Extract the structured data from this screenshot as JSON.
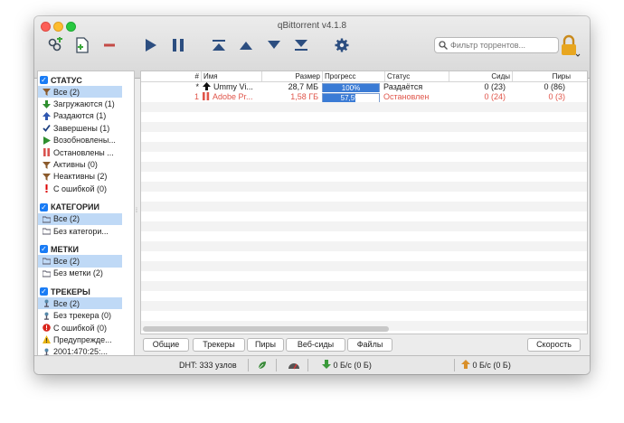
{
  "window": {
    "title": "qBittorrent v4.1.8"
  },
  "toolbar": {
    "buttons": [
      {
        "name": "add-link-icon"
      },
      {
        "name": "add-file-icon"
      },
      {
        "name": "remove-icon"
      },
      {
        "name": "resume-icon"
      },
      {
        "name": "pause-icon"
      },
      {
        "name": "move-top-icon"
      },
      {
        "name": "move-up-icon"
      },
      {
        "name": "move-down-icon"
      },
      {
        "name": "move-bottom-icon"
      },
      {
        "name": "gear-icon"
      }
    ],
    "search_placeholder": "Фильтр торрентов..."
  },
  "sidebar": {
    "status": {
      "title": "СТАТУС",
      "items": [
        {
          "label": "Все (2)",
          "icon": "filter-icon",
          "selected": true
        },
        {
          "label": "Загружаются (1)",
          "icon": "download-arrow-icon"
        },
        {
          "label": "Раздаются (1)",
          "icon": "upload-arrow-icon"
        },
        {
          "label": "Завершены (1)",
          "icon": "checkmark-icon"
        },
        {
          "label": "Возобновлены...",
          "icon": "play-icon"
        },
        {
          "label": "Остановлены ...",
          "icon": "pause-icon"
        },
        {
          "label": "Активны (0)",
          "icon": "filter-icon"
        },
        {
          "label": "Неактивны (2)",
          "icon": "filter-icon"
        },
        {
          "label": "С ошибкой (0)",
          "icon": "exclamation-icon"
        }
      ]
    },
    "categories": {
      "title": "КАТЕГОРИИ",
      "items": [
        {
          "label": "Все (2)",
          "icon": "folder-icon",
          "selected": true
        },
        {
          "label": "Без категори...",
          "icon": "folder-icon"
        }
      ]
    },
    "tags": {
      "title": "МЕТКИ",
      "items": [
        {
          "label": "Все (2)",
          "icon": "folder-icon",
          "selected": true
        },
        {
          "label": "Без метки (2)",
          "icon": "folder-icon"
        }
      ]
    },
    "trackers": {
      "title": "ТРЕКЕРЫ",
      "items": [
        {
          "label": "Все (2)",
          "icon": "tracker-icon",
          "selected": true
        },
        {
          "label": "Без трекера (0)",
          "icon": "tracker-icon"
        },
        {
          "label": "С ошибкой (0)",
          "icon": "error-icon"
        },
        {
          "label": "Предупрежде...",
          "icon": "warning-icon"
        },
        {
          "label": "2001:470:25:...",
          "icon": "tracker-icon"
        }
      ]
    }
  },
  "table": {
    "headers": {
      "num": "#",
      "name": "Имя",
      "size": "Размер",
      "progress": "Прогресс",
      "status": "Статус",
      "seeds": "Сиды",
      "peers": "Пиры"
    },
    "rows": [
      {
        "num": "*",
        "name": "Ummy Vi...",
        "size": "28,7 МБ",
        "progress": 1.0,
        "progress_text": "100%",
        "status": "Раздаётся",
        "seeds": "0 (23)",
        "peers": "0 (86)",
        "state": "seeding"
      },
      {
        "num": "1",
        "name": "Adobe Pr...",
        "size": "1,58 ГБ",
        "progress": 0.575,
        "progress_text": "57,5%",
        "status": "Остановлен",
        "seeds": "0 (24)",
        "peers": "0 (3)",
        "state": "stopped"
      }
    ]
  },
  "tabs": [
    "Общие",
    "Трекеры",
    "Пиры",
    "Веб-сиды",
    "Файлы"
  ],
  "speed_button": "Скорость",
  "statusbar": {
    "dht": "DHT: 333 узлов",
    "download": "0 Б/с (0 Б)",
    "upload": "0 Б/с (0 Б)"
  },
  "colors": {
    "accent": "#1a7cf5",
    "stopped": "#e0554a",
    "selection": "#bfd9f6",
    "progress": "#3a7bd5"
  }
}
